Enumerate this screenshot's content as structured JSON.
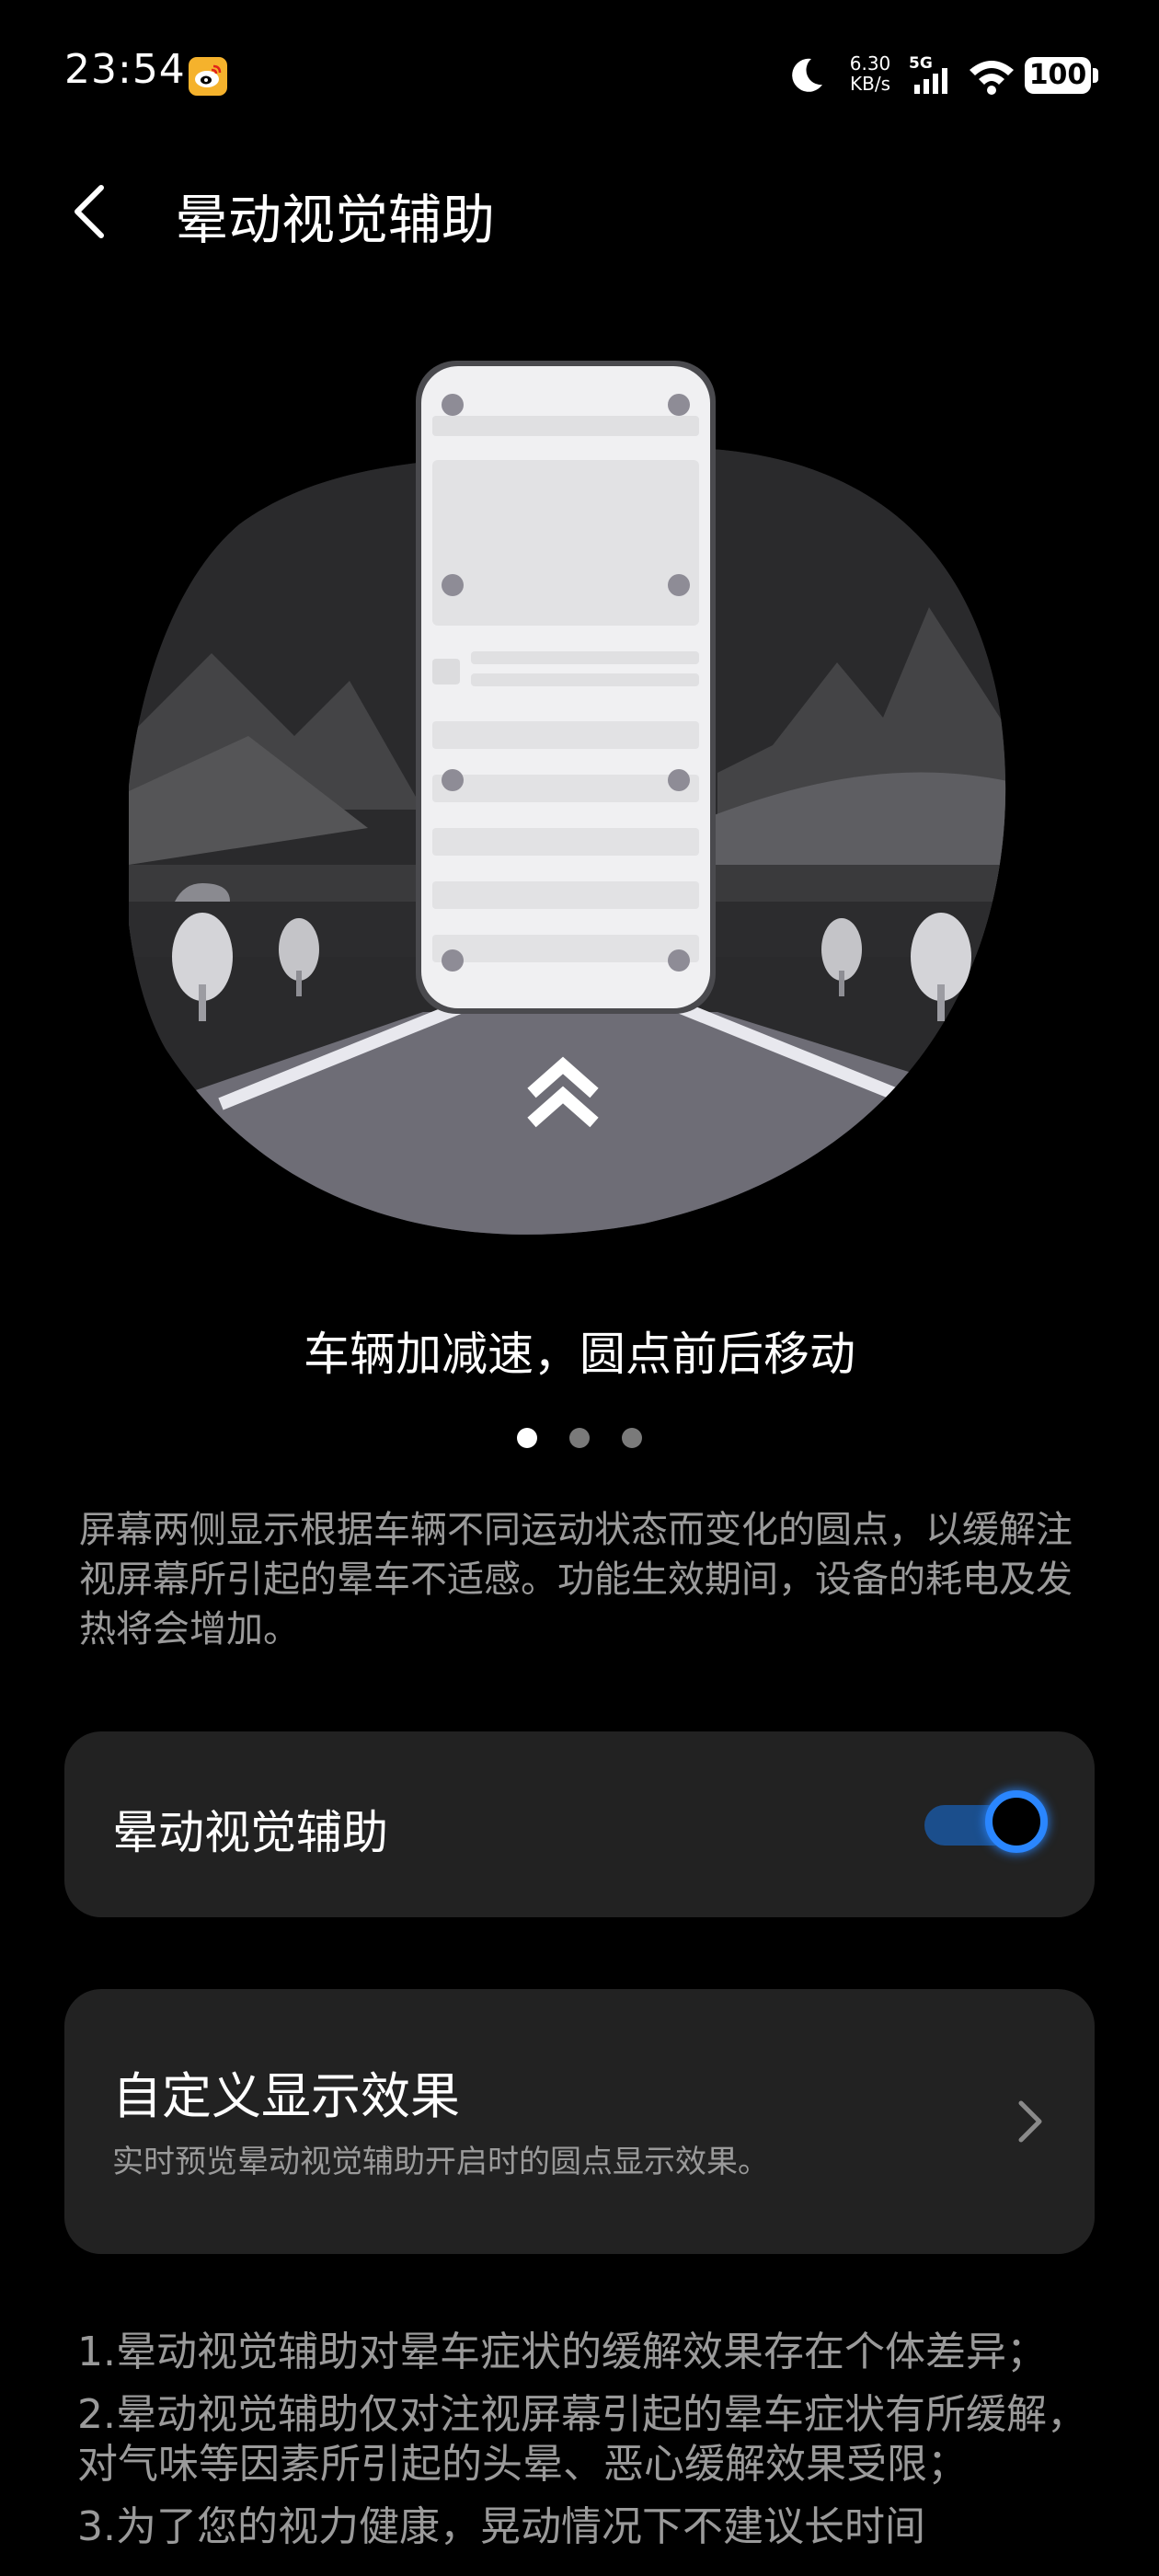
{
  "status_bar": {
    "time": "23:54",
    "net_speed_value": "6.30",
    "net_speed_unit": "KB/s",
    "network_type": "5G",
    "battery": "100"
  },
  "header": {
    "title": "晕动视觉辅助"
  },
  "carousel": {
    "caption": "车辆加减速，圆点前后移动",
    "page_count": 3,
    "active_index": 0
  },
  "description": "屏幕两侧显示根据车辆不同运动状态而变化的圆点，以缓解注视屏幕所引起的晕车不适感。功能生效期间，设备的耗电及发热将会增加。",
  "toggle_card": {
    "label": "晕动视觉辅助",
    "enabled": true
  },
  "custom_card": {
    "title": "自定义显示效果",
    "subtitle": "实时预览晕动视觉辅助开启时的圆点显示效果。"
  },
  "notes": [
    "1.晕动视觉辅助对晕车症状的缓解效果存在个体差异；",
    "2.晕动视觉辅助仅对注视屏幕引起的晕车症状有所缓解，对气味等因素所引起的头晕、恶心缓解效果受限；",
    "3.为了您的视力健康，晃动情况下不建议长时间"
  ],
  "colors": {
    "accent": "#2a86ff",
    "background": "#000000",
    "card": "#222222",
    "secondary_text": "#9a9a9a"
  }
}
